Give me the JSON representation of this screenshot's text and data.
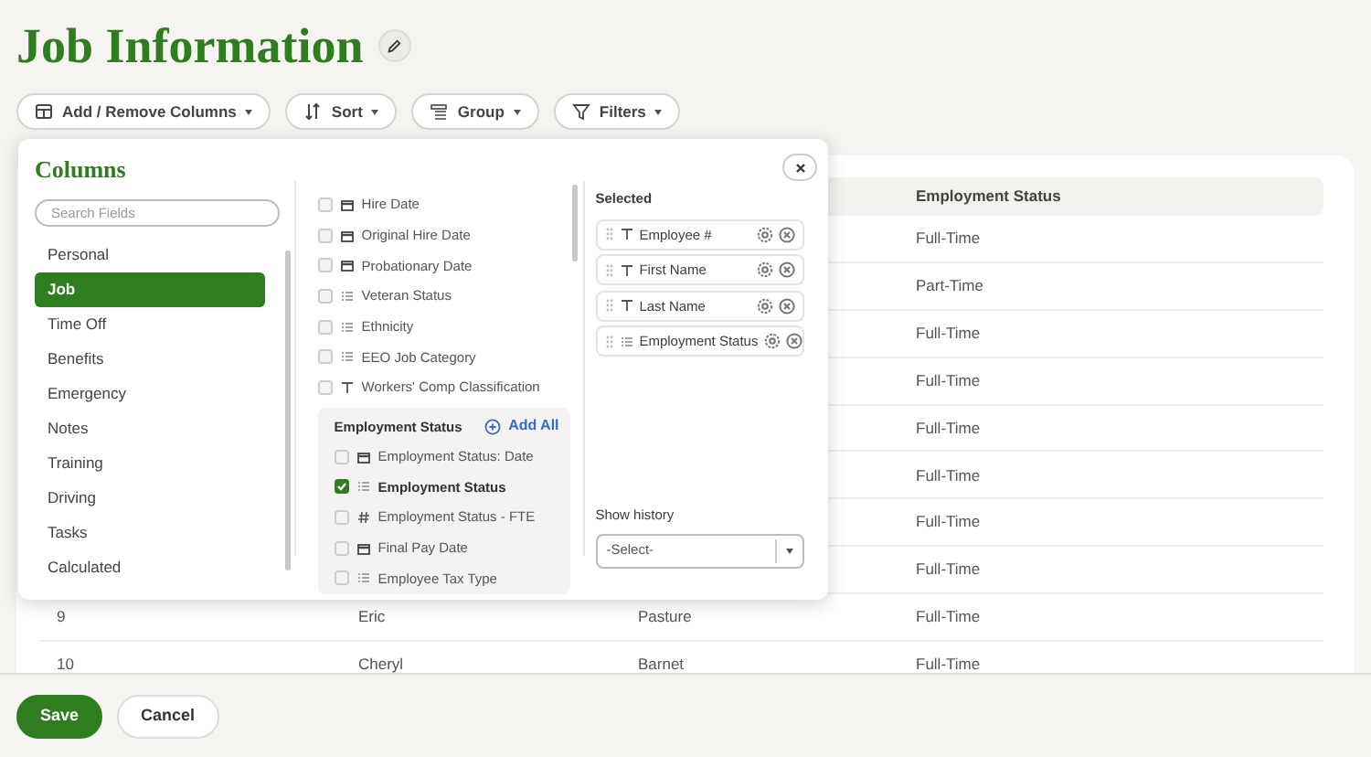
{
  "page": {
    "title": "Job Information"
  },
  "toolbar": [
    {
      "label": "Add / Remove Columns",
      "kind": "columns"
    },
    {
      "label": "Sort",
      "kind": "sort"
    },
    {
      "label": "Group",
      "kind": "group"
    },
    {
      "label": "Filters",
      "kind": "filter"
    }
  ],
  "columns_popup": {
    "title": "Columns",
    "search": {
      "placeholder": "Search Fields"
    },
    "categories": [
      {
        "label": "Personal",
        "selected": false
      },
      {
        "label": "Job",
        "selected": true
      },
      {
        "label": "Time Off",
        "selected": false
      },
      {
        "label": "Benefits",
        "selected": false
      },
      {
        "label": "Emergency",
        "selected": false
      },
      {
        "label": "Notes",
        "selected": false
      },
      {
        "label": "Training",
        "selected": false
      },
      {
        "label": "Driving",
        "selected": false
      },
      {
        "label": "Tasks",
        "selected": false
      },
      {
        "label": "Calculated",
        "selected": false
      }
    ],
    "fields": [
      {
        "label": "Hire Date",
        "kind": "date",
        "checked": false
      },
      {
        "label": "Original Hire Date",
        "kind": "date",
        "checked": false
      },
      {
        "label": "Probationary Date",
        "kind": "date",
        "checked": false
      },
      {
        "label": "Veteran Status",
        "kind": "list",
        "checked": false
      },
      {
        "label": "Ethnicity",
        "kind": "list",
        "checked": false
      },
      {
        "label": "EEO Job Category",
        "kind": "list",
        "checked": false
      },
      {
        "label": "Workers' Comp Classification",
        "kind": "text",
        "checked": false
      }
    ],
    "group": {
      "title": "Employment Status",
      "action": "Add All",
      "fields": [
        {
          "label": "Employment Status: Date",
          "kind": "date",
          "checked": false
        },
        {
          "label": "Employment Status",
          "kind": "list",
          "checked": true
        },
        {
          "label": "Employment Status - FTE",
          "kind": "number",
          "checked": false
        },
        {
          "label": "Final Pay Date",
          "kind": "date",
          "checked": false
        },
        {
          "label": "Employee Tax Type",
          "kind": "list",
          "checked": false
        }
      ]
    },
    "selected_title": "Selected",
    "selected_fields": [
      {
        "label": "Employee #",
        "kind": "text"
      },
      {
        "label": "First Name",
        "kind": "text"
      },
      {
        "label": "Last Name",
        "kind": "text"
      },
      {
        "label": "Employment Status",
        "kind": "list"
      }
    ],
    "history": {
      "label": "Show history",
      "placeholder": "-Select-"
    }
  },
  "table": {
    "column_4_header": "Employment Status",
    "rows": [
      {
        "employment_status": "Full-Time"
      },
      {
        "employment_status": "Part-Time"
      },
      {
        "employment_status": "Full-Time"
      },
      {
        "employment_status": "Full-Time"
      },
      {
        "employment_status": "Full-Time"
      },
      {
        "employment_status": "Full-Time"
      },
      {
        "employment_status": "Full-Time"
      },
      {
        "employment_status": "Full-Time"
      },
      {
        "column_1": "9",
        "column_2": "Eric",
        "column_3": "Pasture",
        "employment_status": "Full-Time"
      },
      {
        "column_1": "10",
        "column_2": "Cheryl",
        "column_3": "Barnet",
        "employment_status": "Full-Time"
      }
    ]
  },
  "footer": {
    "buttons": [
      {
        "label": "Save",
        "kind": "primary"
      },
      {
        "label": "Cancel",
        "kind": "secondary"
      }
    ]
  }
}
